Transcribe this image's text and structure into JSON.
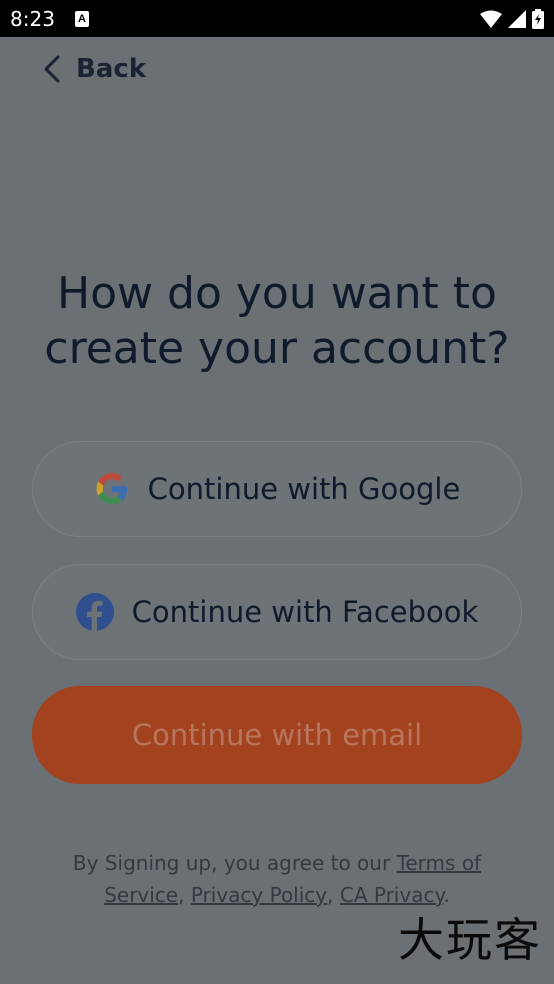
{
  "status_bar": {
    "time": "8:23",
    "a_label": "A"
  },
  "header": {
    "back_label": "Back"
  },
  "title": {
    "line1": "How do you want to",
    "line2": "create your account?"
  },
  "buttons": {
    "google": "Continue with Google",
    "facebook": "Continue with Facebook",
    "email": "Continue with email"
  },
  "legal": {
    "prefix": "By Signing up, you agree to our ",
    "terms": "Terms of Service",
    "sep1": ", ",
    "privacy": "Privacy Policy",
    "sep2": ", ",
    "ca_privacy": "CA Privacy",
    "suffix": "."
  },
  "watermark": "大玩客"
}
